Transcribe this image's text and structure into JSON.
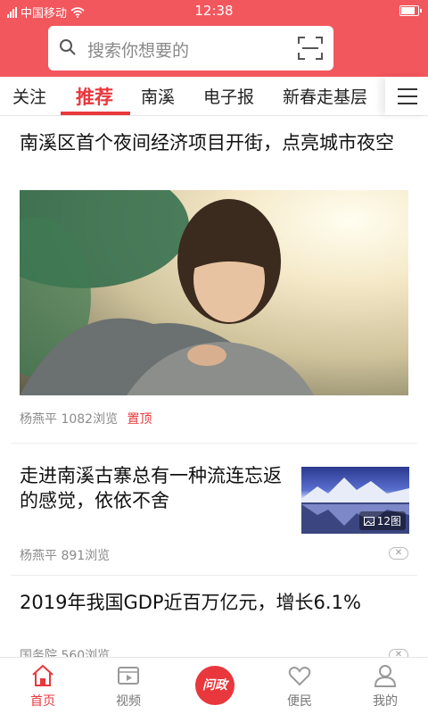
{
  "status_bar": {
    "carrier": "中国移动",
    "time": "12:38",
    "icons": [
      "signal-icon",
      "wifi-icon",
      "battery-icon"
    ]
  },
  "search": {
    "placeholder": "搜索你想要的",
    "icons": [
      "search-icon",
      "scan-icon"
    ]
  },
  "tabs": [
    {
      "label": "关注"
    },
    {
      "label": "推荐",
      "active": true
    },
    {
      "label": "南溪"
    },
    {
      "label": "电子报"
    },
    {
      "label": "新春走基层"
    }
  ],
  "articles": [
    {
      "title": "南溪区首个夜间经济项目开街，点亮城市夜空",
      "author": "杨燕平",
      "views": "1082浏览",
      "tag": "置顶"
    },
    {
      "title": "走进南溪古寨总有一种流连忘返的感觉，依依不舍",
      "author": "杨燕平",
      "views": "891浏览",
      "image_count": "12图"
    },
    {
      "title": "2019年我国GDP近百万亿元，增长6.1%",
      "author": "国务院",
      "views": "560浏览"
    }
  ],
  "bottom_nav": [
    {
      "label": "首页",
      "icon": "home-icon",
      "active": true
    },
    {
      "label": "视频",
      "icon": "video-icon"
    },
    {
      "label": "问政",
      "icon": "wenzheng-badge"
    },
    {
      "label": "便民",
      "icon": "heart-icon"
    },
    {
      "label": "我的",
      "icon": "user-icon"
    }
  ],
  "colors": {
    "header": "#f2575d",
    "accent": "#e8383d"
  }
}
